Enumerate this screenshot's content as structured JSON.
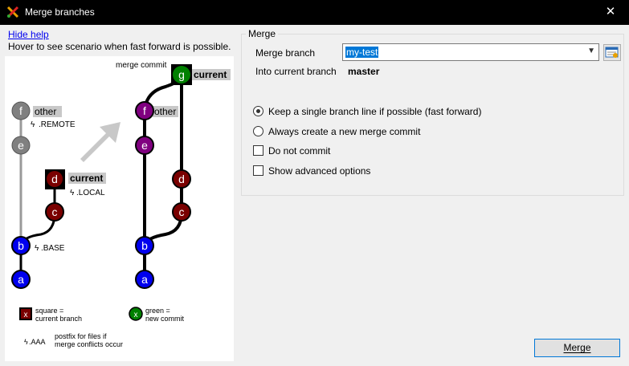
{
  "window": {
    "title": "Merge branches",
    "close_glyph": "✕"
  },
  "help": {
    "hide_link": "Hide help",
    "hover_text": "Hover to see scenario when fast forward is possible."
  },
  "diagram": {
    "labels": {
      "merge_commit": "merge commit",
      "other": "other",
      "current": "current",
      "remote": ".REMOTE",
      "local": ".LOCAL",
      "base": ".BASE"
    },
    "commits": {
      "a": "a",
      "b": "b",
      "c": "c",
      "d": "d",
      "e": "e",
      "f": "f",
      "g": "g"
    },
    "legend": {
      "square_line1": "square =",
      "square_line2": "current branch",
      "green_line1": "green =",
      "green_line2": "new commit",
      "x": "x",
      "aaa": ".AAA",
      "postfix_line1": "postfix for files if",
      "postfix_line2": "merge conflicts occur"
    },
    "colors": {
      "blue": "#0000ee",
      "maroon": "#7a0000",
      "purple": "#800080",
      "green": "#008000",
      "grey": "#808080"
    }
  },
  "merge": {
    "group_title": "Merge",
    "branch_label": "Merge branch",
    "branch_value": "my-test",
    "into_label": "Into current branch",
    "into_value": "master",
    "options": {
      "fast_forward": "Keep a single branch line if possible (fast forward)",
      "always_new": "Always create a new merge commit",
      "do_not_commit": "Do not commit",
      "advanced": "Show advanced options"
    },
    "fast_forward_selected": true,
    "merge_button": "Merge"
  }
}
